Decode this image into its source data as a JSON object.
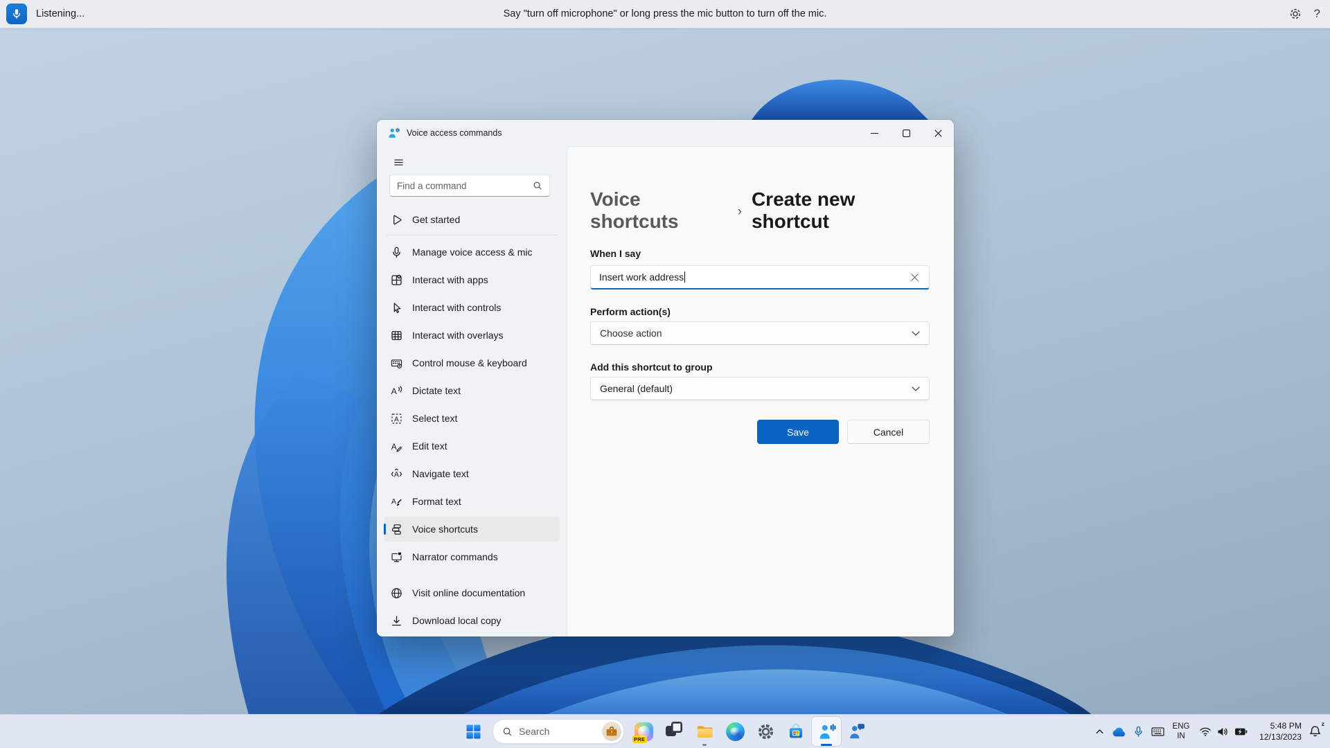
{
  "colors": {
    "accent": "#0B64C4",
    "save_button": "#0B64C4",
    "selected_item_bg": "#E9E9EA"
  },
  "voice_bar": {
    "mic_button": "microphone-icon",
    "status": "Listening...",
    "message": "Say \"turn off microphone\" or long press the mic button to turn off the mic.",
    "settings_icon": "gear-icon",
    "help_icon": "question-mark-icon",
    "help_label": "?"
  },
  "window": {
    "title": "Voice access commands",
    "controls": {
      "minimize": "minimize-icon",
      "maximize": "maximize-icon",
      "close": "close-icon"
    },
    "sidebar": {
      "menu_button": "hamburger-icon",
      "search_placeholder": "Find a command",
      "items": [
        {
          "name": "get-started",
          "icon": "play-icon",
          "sym": "s-play",
          "label": "Get started",
          "divider_after": true
        },
        {
          "name": "manage-voice-access-mic",
          "icon": "microphone-icon",
          "sym": "s-mic",
          "label": "Manage voice access & mic"
        },
        {
          "name": "interact-with-apps",
          "icon": "apps-icon",
          "sym": "s-apps",
          "label": "Interact with apps"
        },
        {
          "name": "interact-with-controls",
          "icon": "cursor-icon",
          "sym": "s-cursor",
          "label": "Interact with controls"
        },
        {
          "name": "interact-with-overlays",
          "icon": "overlay-grid-icon",
          "sym": "s-grid",
          "label": "Interact with overlays"
        },
        {
          "name": "control-mouse-keyboard",
          "icon": "keyboard-touch-icon",
          "sym": "s-keyboard",
          "label": "Control mouse & keyboard"
        },
        {
          "name": "dictate-text",
          "icon": "dictate-icon",
          "sym": "s-dictate",
          "label": "Dictate text"
        },
        {
          "name": "select-text",
          "icon": "select-text-icon",
          "sym": "s-select",
          "label": "Select text"
        },
        {
          "name": "edit-text",
          "icon": "edit-text-icon",
          "sym": "s-edit",
          "label": "Edit text"
        },
        {
          "name": "navigate-text",
          "icon": "navigate-text-icon",
          "sym": "s-navigate",
          "label": "Navigate text"
        },
        {
          "name": "format-text",
          "icon": "format-text-icon",
          "sym": "s-format",
          "label": "Format text"
        },
        {
          "name": "voice-shortcuts",
          "icon": "voice-shortcuts-icon",
          "sym": "s-shortcuts",
          "label": "Voice shortcuts",
          "selected": true
        },
        {
          "name": "narrator-commands",
          "icon": "narrator-icon",
          "sym": "s-narrator",
          "label": "Narrator commands"
        }
      ],
      "footer_items": [
        {
          "name": "visit-online-documentation",
          "icon": "globe-icon",
          "sym": "s-globe",
          "label": "Visit online documentation"
        },
        {
          "name": "download-local-copy",
          "icon": "download-icon",
          "sym": "s-download",
          "label": "Download local copy"
        }
      ]
    },
    "content": {
      "breadcrumb_parent": "Voice shortcuts",
      "breadcrumb_separator": "›",
      "breadcrumb_current": "Create new shortcut",
      "when_label": "When I say",
      "when_value": "Insert work address",
      "clear_icon": "close-icon",
      "perform_label": "Perform action(s)",
      "perform_value": "Choose action",
      "group_label": "Add this shortcut to group",
      "group_value": "General (default)",
      "save_label": "Save",
      "cancel_label": "Cancel"
    }
  },
  "taskbar": {
    "search_placeholder": "Search",
    "copilot_badge": "PRE",
    "apps": [
      {
        "name": "start",
        "icon": "windows-logo-icon"
      },
      {
        "name": "search",
        "icon": "search-icon"
      },
      {
        "name": "copilot",
        "icon": "copilot-icon",
        "badge": "PRE"
      },
      {
        "name": "task-view",
        "icon": "task-view-icon"
      },
      {
        "name": "file-explorer",
        "icon": "folder-icon",
        "running": true
      },
      {
        "name": "edge",
        "icon": "edge-icon"
      },
      {
        "name": "settings",
        "icon": "gear-icon"
      },
      {
        "name": "store",
        "icon": "store-icon"
      },
      {
        "name": "voice-access",
        "icon": "voice-access-icon",
        "active": true
      },
      {
        "name": "get-help",
        "icon": "person-chat-icon"
      }
    ],
    "tray": {
      "hidden_icons": "chevron-up-icon",
      "onedrive": "cloud-icon",
      "mic": "microphone-icon",
      "touch_keyboard": "keyboard-icon",
      "language_line1": "ENG",
      "language_line2": "IN",
      "network": "wifi-icon",
      "volume": "speaker-icon",
      "battery": "battery-charging-icon",
      "time": "5:48 PM",
      "date": "12/13/2023",
      "notifications": "bell-icon"
    }
  }
}
